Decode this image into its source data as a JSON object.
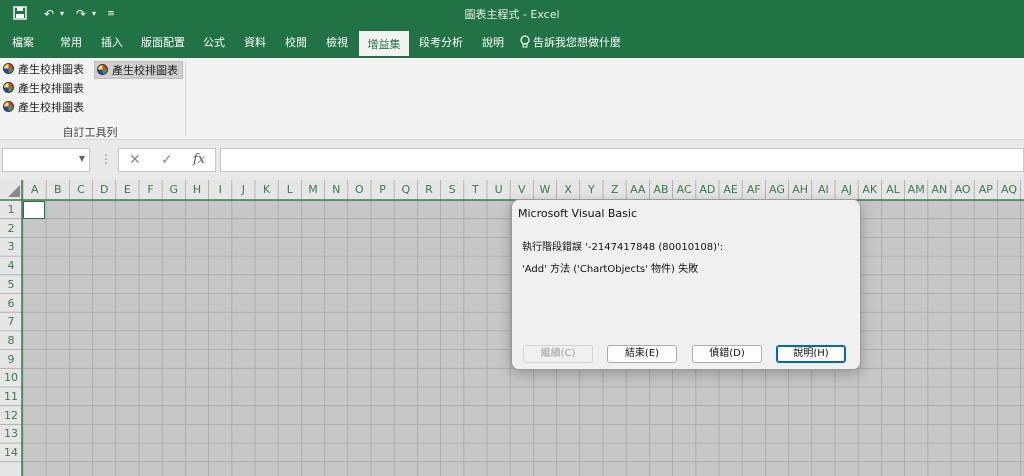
{
  "window": {
    "title": "圖表主程式 - Excel"
  },
  "quick_access": {
    "save_icon": "save-icon",
    "undo_icon": "undo-icon",
    "redo_icon": "redo-icon",
    "customize_icon": "customize-icon"
  },
  "tabs": [
    "檔案",
    "常用",
    "插入",
    "版面配置",
    "公式",
    "資料",
    "校閱",
    "檢視",
    "增益集",
    "段考分析",
    "說明"
  ],
  "tell_me": {
    "icon": "lightbulb-icon",
    "label": "告訴我您想做什麼"
  },
  "ribbon": {
    "items": [
      "產生校排圖表",
      "產生校排圖表",
      "產生校排圖表"
    ],
    "large_item": "產生校排圖表",
    "group_label": "自訂工具列"
  },
  "formula_bar": {
    "name_box": "",
    "fx": "fx",
    "cancel": "✕",
    "enter": "✓",
    "value": ""
  },
  "sheet": {
    "columns": [
      "A",
      "B",
      "C",
      "D",
      "E",
      "F",
      "G",
      "H",
      "I",
      "J",
      "K",
      "L",
      "M",
      "N",
      "O",
      "P",
      "Q",
      "R",
      "S",
      "T",
      "U",
      "V",
      "W",
      "X",
      "Y",
      "Z",
      "AA",
      "AB",
      "AC",
      "AD",
      "AE",
      "AF",
      "AG",
      "AH",
      "AI",
      "AJ",
      "AK",
      "AL",
      "AM",
      "AN",
      "AO",
      "AP",
      "AQ",
      "A"
    ],
    "rows": [
      "1",
      "2",
      "3",
      "4",
      "5",
      "6",
      "7",
      "8",
      "9",
      "10",
      "11",
      "12",
      "13",
      "14"
    ]
  },
  "dialog": {
    "title": "Microsoft Visual Basic",
    "message1": "執行階段錯誤 '-2147417848 (80010108)':",
    "message2": "'Add' 方法 ('ChartObjects' 物件) 失敗",
    "buttons": {
      "continue": "繼續(C)",
      "end": "結束(E)",
      "debug": "偵錯(D)",
      "help": "說明(H)"
    }
  },
  "colors": {
    "brand": "#217346",
    "header_text": "#3a7a52"
  }
}
